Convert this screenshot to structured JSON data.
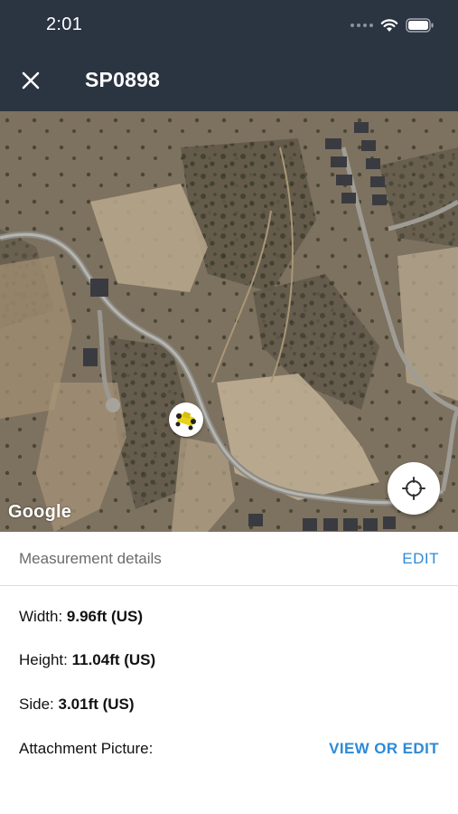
{
  "status_bar": {
    "time": "2:01"
  },
  "nav": {
    "title": "SP0898",
    "close_icon": "close-icon"
  },
  "map": {
    "attribution": "Google",
    "marker_icon": "vehicle-icon",
    "locate_icon": "crosshair-icon"
  },
  "details": {
    "title": "Measurement details",
    "edit_label": "EDIT",
    "rows": [
      {
        "label": "Width: ",
        "value": "9.96ft (US)"
      },
      {
        "label": "Height: ",
        "value": "11.04ft (US)"
      },
      {
        "label": "Side: ",
        "value": "3.01ft (US)"
      }
    ],
    "attachment_label": "Attachment Picture:",
    "attachment_action": "VIEW OR EDIT"
  },
  "colors": {
    "header_bg": "#2b3441",
    "link": "#2d8ad8",
    "marker_yellow": "#e8d21a"
  }
}
